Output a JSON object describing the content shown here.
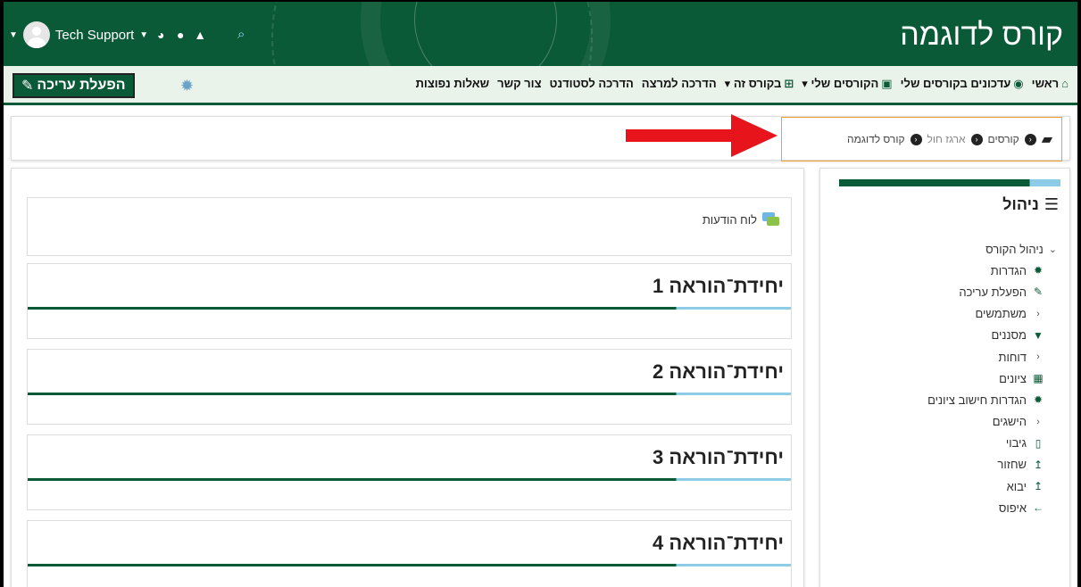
{
  "header": {
    "site_title": "קורס לדוגמה",
    "user_name": "Tech Support"
  },
  "nav": {
    "items": [
      {
        "label": "ראשי",
        "icon": "home-icon"
      },
      {
        "label": "עדכונים בקורסים שלי",
        "icon": "dashboard-icon"
      },
      {
        "label": "הקורסים שלי",
        "icon": "briefcase-icon",
        "dropdown": true
      },
      {
        "label": "בקורס זה",
        "icon": "sitemap-icon",
        "dropdown": true
      },
      {
        "label": "הדרכה למרצה",
        "icon": "",
        "dropdown": false
      },
      {
        "label": "הדרכה לסטודנט",
        "icon": ""
      },
      {
        "label": "צור קשר",
        "icon": ""
      },
      {
        "label": "שאלות נפוצות",
        "icon": ""
      }
    ],
    "edit_button": "הפעלת עריכה"
  },
  "breadcrumb": {
    "items": [
      "קורסים",
      "ארגז חול",
      "קורס לדוגמה"
    ]
  },
  "main": {
    "news_forum": "לוח הודעות",
    "sections": [
      "יחידת־הוראה 1",
      "יחידת־הוראה 2",
      "יחידת־הוראה 3",
      "יחידת־הוראה 4"
    ]
  },
  "sidebar": {
    "title": "ניהול",
    "course_admin": "ניהול הקורס",
    "items": [
      {
        "label": "הגדרות",
        "icon": "gear-icon"
      },
      {
        "label": "הפעלת עריכה",
        "icon": "pencil-icon"
      },
      {
        "label": "משתמשים",
        "icon": "chevron-left-icon"
      },
      {
        "label": "מסננים",
        "icon": "filter-icon"
      },
      {
        "label": "דוחות",
        "icon": "chevron-left-icon"
      },
      {
        "label": "ציונים",
        "icon": "table-icon"
      },
      {
        "label": "הגדרות חישוב ציונים",
        "icon": "gear-icon"
      },
      {
        "label": "הישגים",
        "icon": "chevron-left-icon"
      },
      {
        "label": "גיבוי",
        "icon": "file-icon"
      },
      {
        "label": "שחזור",
        "icon": "upload-icon"
      },
      {
        "label": "יבוא",
        "icon": "upload-icon"
      },
      {
        "label": "איפוס",
        "icon": "arrow-left-icon"
      }
    ]
  },
  "colors": {
    "brand": "#0b5a37",
    "accent": "#8ccce6",
    "highlight": "#f0a030",
    "arrow": "#e8141c"
  }
}
